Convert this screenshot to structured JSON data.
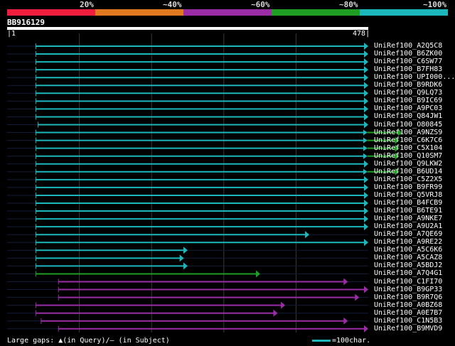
{
  "legend": {
    "colors": [
      "#ef1e3c",
      "#e27920",
      "#9a2da6",
      "#1e9e22",
      "#1bb7bd"
    ],
    "labels": [
      "20%",
      "~40%",
      "~60%",
      "~80%",
      "~100%"
    ]
  },
  "query": {
    "id": "BB916129",
    "start": "1",
    "end": "478",
    "length": 478
  },
  "chart_data": {
    "type": "alignment-overview",
    "query_length": 478,
    "hits": [
      {
        "name": "UniRef100_A2Q5C8",
        "start": 38,
        "end": 478,
        "identity": "~100%"
      },
      {
        "name": "UniRef100_B6ZK00",
        "start": 38,
        "end": 478,
        "identity": "~100%"
      },
      {
        "name": "UniRef100_C6SW77",
        "start": 38,
        "end": 478,
        "identity": "~100%"
      },
      {
        "name": "UniRef100_B7FH83",
        "start": 38,
        "end": 478,
        "identity": "~100%"
      },
      {
        "name": "UniRef100_UPI000...",
        "start": 38,
        "end": 478,
        "identity": "~100%"
      },
      {
        "name": "UniRef100_B9RDK6",
        "start": 38,
        "end": 478,
        "identity": "~100%"
      },
      {
        "name": "UniRef100_Q9LQ73",
        "start": 38,
        "end": 478,
        "identity": "~100%"
      },
      {
        "name": "UniRef100_B9IC69",
        "start": 38,
        "end": 478,
        "identity": "~100%"
      },
      {
        "name": "UniRef100_A9PC03",
        "start": 38,
        "end": 478,
        "identity": "~100%"
      },
      {
        "name": "UniRef100_Q84JW1",
        "start": 38,
        "end": 478,
        "identity": "~100%"
      },
      {
        "name": "UniRef100_O80845",
        "start": 41,
        "end": 478,
        "identity": "~100%"
      },
      {
        "name": "UniRef100_A9NZS9",
        "start": 38,
        "end": 477,
        "identity": "~100%",
        "ext_end": 523,
        "ext_identity": "~80%"
      },
      {
        "name": "UniRef100_C6K7C6",
        "start": 38,
        "end": 477,
        "identity": "~100%",
        "ext_end": 519,
        "ext_identity": "~80%"
      },
      {
        "name": "UniRef100_C5X104",
        "start": 38,
        "end": 477,
        "identity": "~100%",
        "ext_end": 519,
        "ext_identity": "~80%"
      },
      {
        "name": "UniRef100_Q10SM7",
        "start": 38,
        "end": 477,
        "identity": "~100%",
        "ext_end": 519,
        "ext_identity": "~80%"
      },
      {
        "name": "UniRef100_Q9LKW2",
        "start": 38,
        "end": 478,
        "identity": "~100%"
      },
      {
        "name": "UniRef100_B6UD14",
        "start": 38,
        "end": 477,
        "identity": "~100%",
        "ext_end": 519,
        "ext_identity": "~80%"
      },
      {
        "name": "UniRef100_C5Z2X5",
        "start": 38,
        "end": 478,
        "identity": "~100%"
      },
      {
        "name": "UniRef100_B9FR99",
        "start": 38,
        "end": 478,
        "identity": "~100%"
      },
      {
        "name": "UniRef100_Q5VRJ8",
        "start": 38,
        "end": 478,
        "identity": "~100%"
      },
      {
        "name": "UniRef100_B4FCB9",
        "start": 38,
        "end": 478,
        "identity": "~100%"
      },
      {
        "name": "UniRef100_B6TE91",
        "start": 38,
        "end": 478,
        "identity": "~100%"
      },
      {
        "name": "UniRef100_A9NKE7",
        "start": 38,
        "end": 478,
        "identity": "~100%"
      },
      {
        "name": "UniRef100_A9U2A1",
        "start": 38,
        "end": 478,
        "identity": "~100%"
      },
      {
        "name": "UniRef100_A7QE69",
        "start": 38,
        "end": 400,
        "identity": "~100%"
      },
      {
        "name": "UniRef100_A9RE22",
        "start": 38,
        "end": 478,
        "identity": "~100%"
      },
      {
        "name": "UniRef100_A5C6K6",
        "start": 38,
        "end": 239,
        "identity": "~100%"
      },
      {
        "name": "UniRef100_A5CAZ8",
        "start": 38,
        "end": 234,
        "identity": "~100%"
      },
      {
        "name": "UniRef100_A5BDJ2",
        "start": 38,
        "end": 239,
        "identity": "~100%"
      },
      {
        "name": "UniRef100_A7Q4G1",
        "start": 38,
        "end": 335,
        "identity": "~80%"
      },
      {
        "name": "UniRef100_C1FI70",
        "start": 68,
        "end": 451,
        "identity": "~60%"
      },
      {
        "name": "UniRef100_B9GP33",
        "start": 68,
        "end": 478,
        "identity": "~60%"
      },
      {
        "name": "UniRef100_B9R7Q6",
        "start": 68,
        "end": 466,
        "identity": "~60%"
      },
      {
        "name": "UniRef100_A0BZ68",
        "start": 38,
        "end": 368,
        "identity": "~60%"
      },
      {
        "name": "UniRef100_A0E7B7",
        "start": 38,
        "end": 358,
        "identity": "~60%"
      },
      {
        "name": "UniRef100_C1N5B3",
        "start": 45,
        "end": 451,
        "identity": "~60%"
      },
      {
        "name": "UniRef100_B9MVD9",
        "start": 68,
        "end": 478,
        "identity": "~60%"
      }
    ]
  },
  "footer": {
    "gaps_note": "Large gaps: ▲(in Query)/– (in Subject)",
    "scale_note": "=100char."
  }
}
